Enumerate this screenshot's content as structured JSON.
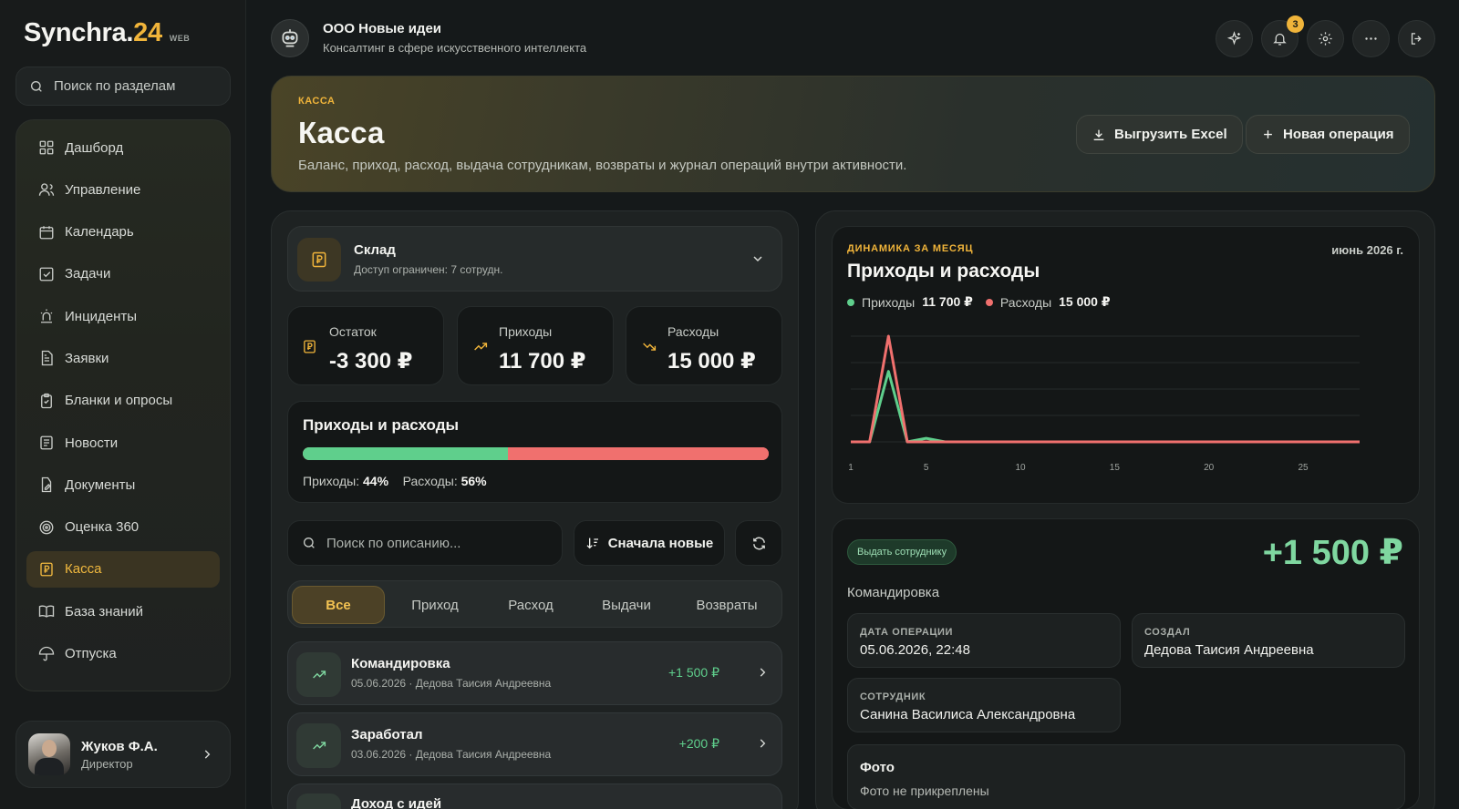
{
  "sidebar": {
    "brand": "Synchra.",
    "brand_accent": "24",
    "brand_tag": "WEB",
    "search_placeholder": "Поиск по разделам",
    "items": [
      {
        "label": "Дашборд",
        "icon": "grid-icon"
      },
      {
        "label": "Управление",
        "icon": "users-icon"
      },
      {
        "label": "Календарь",
        "icon": "calendar-icon"
      },
      {
        "label": "Задачи",
        "icon": "check-square-icon"
      },
      {
        "label": "Инциденты",
        "icon": "siren-icon"
      },
      {
        "label": "Заявки",
        "icon": "file-text-icon"
      },
      {
        "label": "Бланки и опросы",
        "icon": "clipboard-icon"
      },
      {
        "label": "Новости",
        "icon": "newspaper-icon"
      },
      {
        "label": "Документы",
        "icon": "file-edit-icon"
      },
      {
        "label": "Оценка 360",
        "icon": "target-icon"
      },
      {
        "label": "Касса",
        "icon": "ruble-icon",
        "active": true
      },
      {
        "label": "База знаний",
        "icon": "book-icon"
      },
      {
        "label": "Отпуска",
        "icon": "umbrella-icon"
      }
    ],
    "user": {
      "name": "Жуков Ф.А.",
      "role": "Директор"
    }
  },
  "topbar": {
    "org_name": "ООО Новые идеи",
    "org_sub": "Консалтинг в сфере искусственного интеллекта",
    "notifications_count": "3"
  },
  "hero": {
    "kicker": "КАССА",
    "title": "Касса",
    "description": "Баланс, приход, расход, выдача сотрудникам, возвраты и журнал операций внутри активности.",
    "export_label": "Выгрузить Excel",
    "new_op_label": "Новая операция"
  },
  "warehouse": {
    "name": "Склад",
    "access": "Доступ ограничен: 7 сотрудн."
  },
  "stats": {
    "balance": {
      "label": "Остаток",
      "value": "-3 300 ₽"
    },
    "income": {
      "label": "Приходы",
      "value": "11 700 ₽"
    },
    "expense": {
      "label": "Расходы",
      "value": "15 000 ₽"
    }
  },
  "ratio": {
    "title": "Приходы и расходы",
    "income_label": "Приходы:",
    "income_pct": "44%",
    "income_fraction": 0.44,
    "expense_label": "Расходы:",
    "expense_pct": "56%"
  },
  "filters": {
    "search_placeholder": "Поиск по описанию...",
    "sort_label": "Сначала новые",
    "tabs": [
      "Все",
      "Приход",
      "Расход",
      "Выдачи",
      "Возвраты"
    ],
    "active_tab": 0
  },
  "operations": [
    {
      "title": "Командировка",
      "sub": "05.06.2026 · Дедова Таисия Андреевна",
      "amount": "+1 500 ₽"
    },
    {
      "title": "Заработал",
      "sub": "03.06.2026 · Дедова Таисия Андреевна",
      "amount": "+200 ₽"
    },
    {
      "title": "Доход с идей",
      "sub": "",
      "amount": ""
    }
  ],
  "chart_card": {
    "kicker": "ДИНАМИКА ЗА МЕСЯЦ",
    "date": "июнь 2026 г.",
    "title": "Приходы и расходы",
    "legend_income": "Приходы",
    "legend_income_value": "11 700 ₽",
    "legend_expense": "Расходы",
    "legend_expense_value": "15 000 ₽"
  },
  "chart_data": {
    "type": "line",
    "x": [
      1,
      2,
      3,
      4,
      5,
      6,
      7,
      8,
      9,
      10,
      11,
      12,
      13,
      14,
      15,
      16,
      17,
      18,
      19,
      20,
      21,
      22,
      23,
      24,
      25,
      26,
      27,
      28
    ],
    "x_ticks": [
      1,
      5,
      10,
      15,
      20,
      25
    ],
    "xlim": [
      1,
      28
    ],
    "ylim": [
      0,
      15000
    ],
    "grid": true,
    "legend": "top-left",
    "series": [
      {
        "name": "Приходы",
        "color": "#5fcf8c",
        "values": [
          0,
          0,
          10000,
          0,
          500,
          0,
          0,
          0,
          0,
          0,
          0,
          0,
          0,
          0,
          0,
          0,
          0,
          0,
          0,
          0,
          0,
          0,
          0,
          0,
          0,
          0,
          0,
          0
        ]
      },
      {
        "name": "Расходы",
        "color": "#f0706e",
        "values": [
          0,
          0,
          15000,
          0,
          0,
          0,
          0,
          0,
          0,
          0,
          0,
          0,
          0,
          0,
          0,
          0,
          0,
          0,
          0,
          0,
          0,
          0,
          0,
          0,
          0,
          0,
          0,
          0
        ]
      }
    ]
  },
  "detail": {
    "badge": "Выдать сотруднику",
    "amount": "+1 500 ₽",
    "name": "Командировка",
    "date_label": "ДАТА ОПЕРАЦИИ",
    "date_value": "05.06.2026, 22:48",
    "creator_label": "СОЗДАЛ",
    "creator_value": "Дедова Таисия Андреевна",
    "employee_label": "СОТРУДНИК",
    "employee_value": "Санина Василиса Александровна",
    "photo_label": "Фото",
    "photo_value": "Фото не прикреплены"
  },
  "colors": {
    "accent": "#f0b43a",
    "income": "#5fcf8c",
    "expense": "#f0706e"
  }
}
